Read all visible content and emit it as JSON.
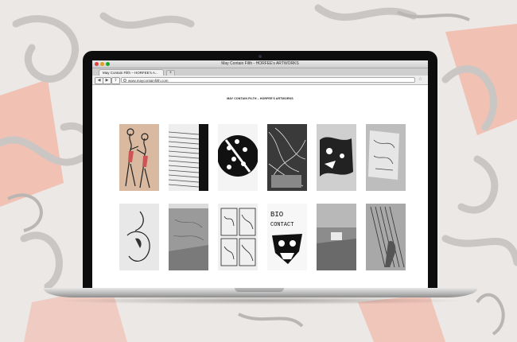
{
  "window": {
    "title": "May Contain Filth - HORFEE's ARTWORKS"
  },
  "tab": {
    "label": "May Contain Filth – HORFEE's A...",
    "new_tab": "+"
  },
  "toolbar": {
    "back": "◀",
    "forward": "▶",
    "share": "⇪"
  },
  "address_bar": {
    "url": "www.maycontainfilth.com"
  },
  "page": {
    "heading": "MAY CONTAIN FILTH – HORFEE'S ARTWORKS"
  },
  "thumbnails": [
    {
      "row": 1,
      "subject": "two-dancing-figures"
    },
    {
      "row": 1,
      "subject": "paper-stack"
    },
    {
      "row": 1,
      "subject": "circle-pattern"
    },
    {
      "row": 1,
      "subject": "abstract-lines"
    },
    {
      "row": 1,
      "subject": "ink-drawing"
    },
    {
      "row": 1,
      "subject": "sketch-papers"
    },
    {
      "row": 2,
      "subject": "character-sketch"
    },
    {
      "row": 2,
      "subject": "gallery-room"
    },
    {
      "row": 2,
      "subject": "comic-sheets"
    },
    {
      "row": 2,
      "subject": "bio-contact",
      "text": [
        "BIO",
        "CONTACT"
      ]
    },
    {
      "row": 2,
      "subject": "street-bench"
    },
    {
      "row": 2,
      "subject": "wall-mural"
    }
  ],
  "colors": {
    "accent_bg": "#f2b7a8",
    "lid": "#0d0d0d"
  }
}
